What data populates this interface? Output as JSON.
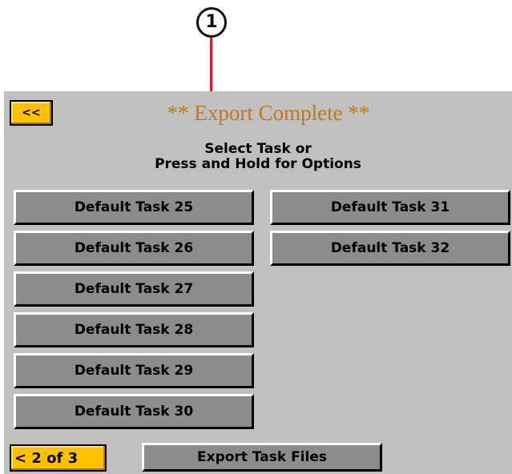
{
  "callout": {
    "number": "1",
    "line_color": "#d81b2a"
  },
  "screen": {
    "back_button_label": "<<",
    "title": "** Export Complete **",
    "title_color": "#c07818",
    "instructions": {
      "line1": "Select Task or",
      "line2": "Press and Hold for Options"
    },
    "tasks_left": [
      {
        "label": "Default Task 25"
      },
      {
        "label": "Default Task 26"
      },
      {
        "label": "Default Task 27"
      },
      {
        "label": "Default Task 28"
      },
      {
        "label": "Default Task 29"
      },
      {
        "label": "Default Task 30"
      }
    ],
    "tasks_right": [
      {
        "label": "Default Task 31"
      },
      {
        "label": "Default Task 32"
      }
    ],
    "page_indicator": "< 2 of 3",
    "export_button_label": "Export Task Files",
    "accent_color": "#ffc000",
    "background_color": "#c0c0c0",
    "button_color": "#8c8c8c"
  }
}
